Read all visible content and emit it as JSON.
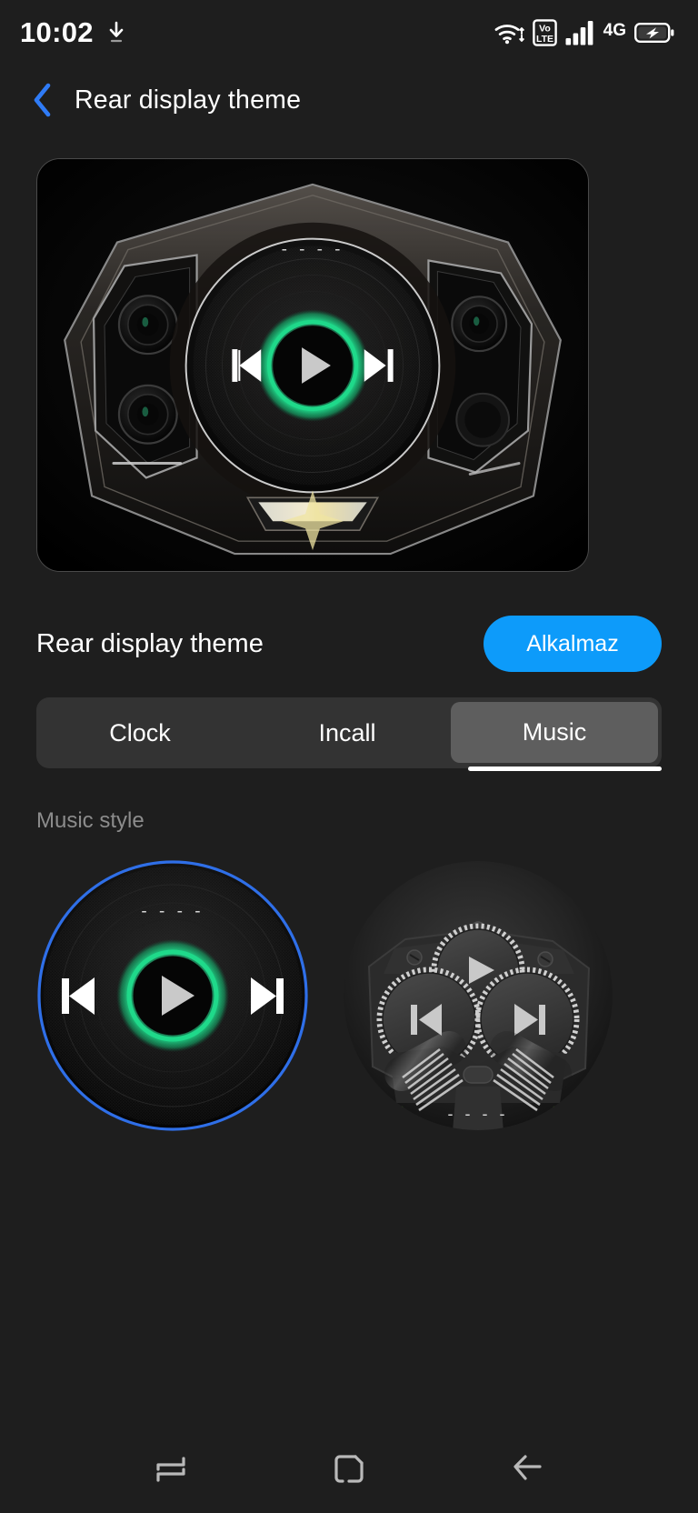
{
  "status_bar": {
    "time": "10:02",
    "icons": {
      "download": "download-icon",
      "wifi": "wifi-icon",
      "volte": "volte-icon",
      "volte_top": "Vo",
      "volte_bottom": "LTE",
      "signal": "signal-bars-icon",
      "network_type": "4G",
      "battery": "battery-charging-icon"
    }
  },
  "header": {
    "back_icon": "back-chevron-icon",
    "title": "Rear display theme",
    "accent_color": "#2f7bf6"
  },
  "preview": {
    "name": "rear-display-preview",
    "track_placeholder": "----",
    "glow_color": "#1fd98a",
    "play_icon": "play-icon",
    "prev_icon": "previous-track-icon",
    "next_icon": "next-track-icon"
  },
  "theme_row": {
    "label": "Rear display theme",
    "apply_label": "Alkalmaz",
    "apply_color": "#0d9bfa"
  },
  "tabs": {
    "items": [
      {
        "label": "Clock",
        "active": false
      },
      {
        "label": "Incall",
        "active": false
      },
      {
        "label": "Music",
        "active": true
      }
    ],
    "active_index": 2
  },
  "section": {
    "music_style_label": "Music style"
  },
  "music_styles": [
    {
      "name": "vinyl-record-style",
      "selected": true,
      "selection_color": "#2f6fe8",
      "track_placeholder": "----",
      "glow_color": "#1fd98a",
      "play_icon": "play-icon",
      "prev_icon": "previous-track-icon",
      "next_icon": "next-track-icon"
    },
    {
      "name": "mechanical-gear-style",
      "selected": false,
      "track_placeholder": "----",
      "play_icon": "play-icon",
      "prev_icon": "previous-track-icon",
      "next_icon": "next-track-icon"
    }
  ],
  "nav_bar": {
    "recent_icon": "recent-apps-icon",
    "home_icon": "home-icon",
    "back_icon": "back-arrow-icon"
  },
  "colors": {
    "background": "#1e1e1e",
    "card_background": "#050505",
    "tab_bar": "#333333",
    "tab_active": "#5e5e5e",
    "muted_text": "#8c8c8c"
  }
}
